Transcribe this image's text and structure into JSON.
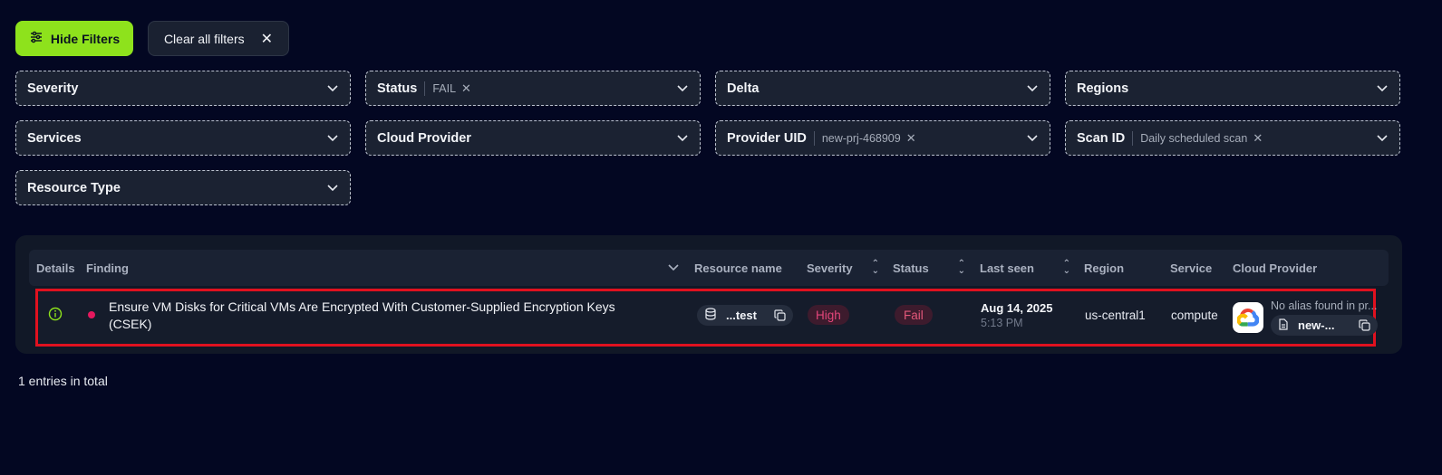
{
  "toolbar": {
    "hide_filters_label": "Hide Filters",
    "clear_all_label": "Clear all filters"
  },
  "filters": {
    "severity": {
      "label": "Severity"
    },
    "status": {
      "label": "Status",
      "chip": "FAIL"
    },
    "delta": {
      "label": "Delta"
    },
    "regions": {
      "label": "Regions"
    },
    "services": {
      "label": "Services"
    },
    "cloud_provider": {
      "label": "Cloud Provider"
    },
    "provider_uid": {
      "label": "Provider UID",
      "chip": "new-prj-468909"
    },
    "scan_id": {
      "label": "Scan ID",
      "chip": "Daily scheduled scan"
    },
    "resource_type": {
      "label": "Resource Type"
    }
  },
  "table": {
    "headers": {
      "details": "Details",
      "finding": "Finding",
      "resource_name": "Resource name",
      "severity": "Severity",
      "status": "Status",
      "last_seen": "Last seen",
      "region": "Region",
      "service": "Service",
      "cloud_provider": "Cloud Provider"
    },
    "rows": [
      {
        "finding": "Ensure VM Disks for Critical VMs Are Encrypted With Customer-Supplied Encryption Keys (CSEK)",
        "resource_name": "...test",
        "severity": "High",
        "status": "Fail",
        "last_seen_date": "Aug 14, 2025",
        "last_seen_time": "5:13 PM",
        "region": "us-central1",
        "service": "compute",
        "provider_alias": "No alias found in pr...",
        "provider_uid": "new-..."
      }
    ]
  },
  "footer": {
    "total": "1 entries in total"
  },
  "colors": {
    "background": "#030722",
    "accent": "#8ee21c",
    "danger": "#e3467a",
    "highlight_border": "#e0111f"
  }
}
